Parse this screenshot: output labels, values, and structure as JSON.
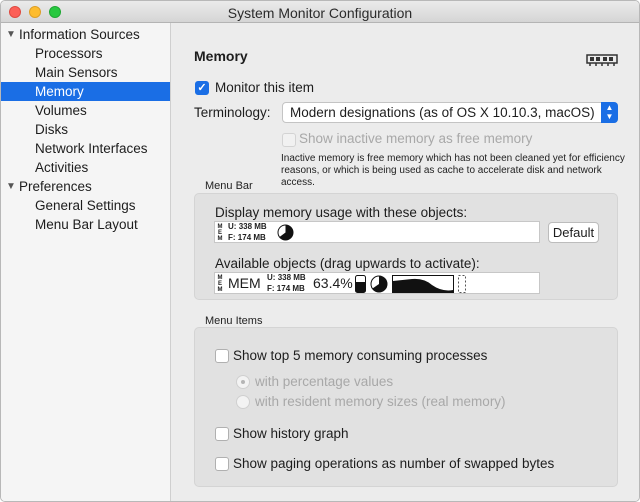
{
  "window": {
    "title": "System Monitor Configuration"
  },
  "sidebar": {
    "groups": [
      {
        "label": "Information Sources",
        "items": [
          "Processors",
          "Main Sensors",
          "Memory",
          "Volumes",
          "Disks",
          "Network Interfaces",
          "Activities"
        ]
      },
      {
        "label": "Preferences",
        "items": [
          "General Settings",
          "Menu Bar Layout"
        ]
      }
    ],
    "selected": "Memory"
  },
  "main": {
    "title": "Memory",
    "monitor_label": "Monitor this item",
    "monitor_checked": true,
    "terminology_label": "Terminology:",
    "terminology_value": "Modern designations (as of OS X 10.10.3, macOS)",
    "inactive_label": "Show inactive memory as free memory",
    "inactive_note": "Inactive memory is free memory which has not been cleaned yet for efficiency reasons, or which is being used as cache to accelerate disk and network access."
  },
  "menu_bar": {
    "section_label": "Menu Bar",
    "display_label": "Display memory usage with these objects:",
    "available_label": "Available objects (drag upwards to activate):",
    "default_button": "Default",
    "mem_vertical": [
      "M",
      "E",
      "M"
    ],
    "used_label": "U:",
    "used_value": "338 MB",
    "free_label": "F:",
    "free_value": "174 MB",
    "mem_text": "MEM",
    "percent_text": "63.4%"
  },
  "menu_items": {
    "section_label": "Menu Items",
    "top5_label": "Show top 5 memory consuming processes",
    "pct_label": "with percentage values",
    "resident_label": "with resident memory sizes (real memory)",
    "history_label": "Show history graph",
    "paging_label": "Show paging operations as number of swapped bytes"
  }
}
